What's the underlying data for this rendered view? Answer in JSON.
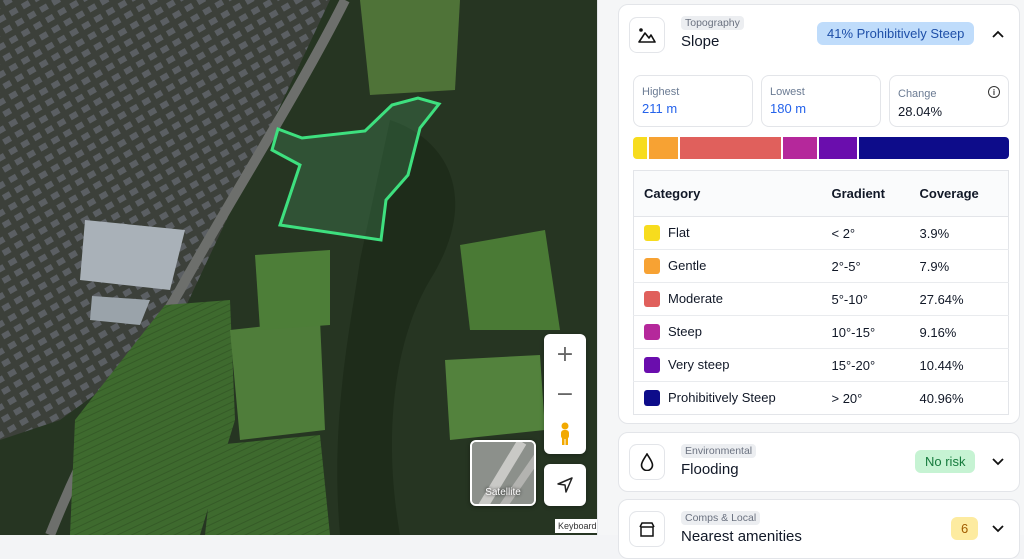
{
  "map": {
    "zoom_in_label": "+",
    "zoom_out_label": "−",
    "satellite_label": "Satellite",
    "keyboard_label": "Keyboard",
    "icons": {
      "zoom_in": "plus-icon",
      "zoom_out": "minus-icon",
      "pegman": "pegman-icon",
      "locate": "navigation-arrow-icon"
    }
  },
  "slope": {
    "kicker": "Topography",
    "title": "Slope",
    "badge": "41% Prohibitively Steep",
    "badge_color": "#bfdcfb",
    "icon": "mountain-icon",
    "stats": [
      {
        "label": "Highest",
        "value": "211 m"
      },
      {
        "label": "Lowest",
        "value": "180 m"
      },
      {
        "label": "Change",
        "value": "28.04%"
      }
    ],
    "table": {
      "headers": [
        "Category",
        "Gradient",
        "Coverage"
      ],
      "rows": [
        {
          "category": "Flat",
          "gradient": "< 2°",
          "coverage": "3.9%",
          "color": "#f7dc1e",
          "share": 3.9
        },
        {
          "category": "Gentle",
          "gradient": "2°-5°",
          "coverage": "7.9%",
          "color": "#f7a233",
          "share": 7.9
        },
        {
          "category": "Moderate",
          "gradient": "5°-10°",
          "coverage": "27.64%",
          "color": "#e0605c",
          "share": 27.64
        },
        {
          "category": "Steep",
          "gradient": "10°-15°",
          "coverage": "9.16%",
          "color": "#b5289b",
          "share": 9.16
        },
        {
          "category": "Very steep",
          "gradient": "15°-20°",
          "coverage": "10.44%",
          "color": "#6a0dad",
          "share": 10.44
        },
        {
          "category": "Prohibitively Steep",
          "gradient": "> 20°",
          "coverage": "40.96%",
          "color": "#0d0c8a",
          "share": 40.96
        }
      ]
    }
  },
  "flooding": {
    "kicker": "Environmental",
    "title": "Flooding",
    "badge": "No risk",
    "badge_color": "#c6f3d3",
    "icon": "water-drop-icon"
  },
  "amenities": {
    "kicker": "Comps & Local",
    "title": "Nearest amenities",
    "badge": "6",
    "badge_color": "#fdeba0",
    "icon": "store-icon"
  }
}
